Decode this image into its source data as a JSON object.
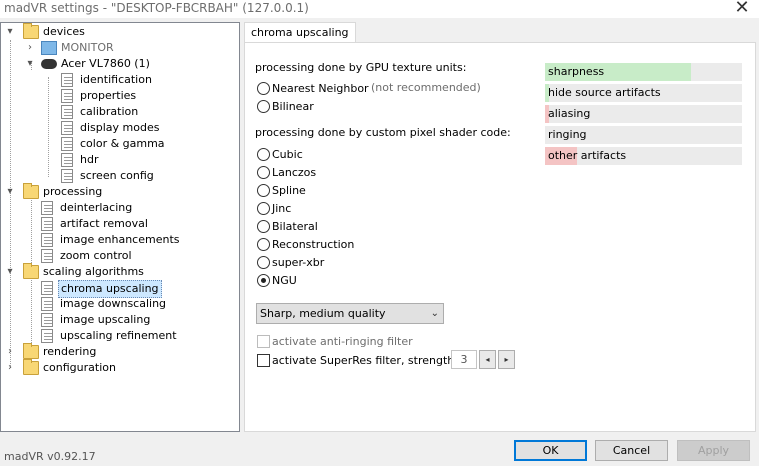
{
  "window": {
    "title": "madVR settings - \"DESKTOP-FBCRBAH\" (127.0.0.1)",
    "close_glyph": "✕",
    "status": "madVR v0.92.17"
  },
  "tree": {
    "devices": "devices",
    "monitor": "MONITOR",
    "acer": "Acer VL7860 (1)",
    "acer_children": [
      "identification",
      "properties",
      "calibration",
      "display modes",
      "color & gamma",
      "hdr",
      "screen config"
    ],
    "processing": "processing",
    "processing_children": [
      "deinterlacing",
      "artifact removal",
      "image enhancements",
      "zoom control"
    ],
    "scaling": "scaling algorithms",
    "scaling_children": [
      "chroma upscaling",
      "image downscaling",
      "image upscaling",
      "upscaling refinement"
    ],
    "rendering": "rendering",
    "configuration": "configuration"
  },
  "panel": {
    "tab": "chroma upscaling",
    "gpu_heading": "processing done by GPU texture units:",
    "gpu_options": [
      "Nearest Neighbor",
      "Bilinear"
    ],
    "nn_note": "(not recommended)",
    "shader_heading": "processing done by custom pixel shader code:",
    "shader_options": [
      "Cubic",
      "Lanczos",
      "Spline",
      "Jinc",
      "Bilateral",
      "Reconstruction",
      "super-xbr",
      "NGU"
    ],
    "selected_option": "NGU",
    "quality_select": "Sharp, medium quality",
    "anti_ringing": "activate anti-ringing filter",
    "superres": "activate SuperRes filter, strength:",
    "superres_strength": "3",
    "spin_left": "◂",
    "spin_right": "▸",
    "quality_bars": [
      {
        "label": "sharpness",
        "level": 0.74,
        "color": "#c8ecc8"
      },
      {
        "label": "hide source artifacts",
        "level": 0.02,
        "color": "#c8ecc8"
      },
      {
        "label": "aliasing",
        "level": 0.02,
        "color": "#f4c4c4"
      },
      {
        "label": "ringing",
        "level": 0.0,
        "color": "#f4c4c4"
      },
      {
        "label": "other artifacts",
        "level": 0.16,
        "color": "#f4c4c4"
      }
    ]
  },
  "buttons": {
    "ok": "OK",
    "cancel": "Cancel",
    "apply": "Apply"
  }
}
